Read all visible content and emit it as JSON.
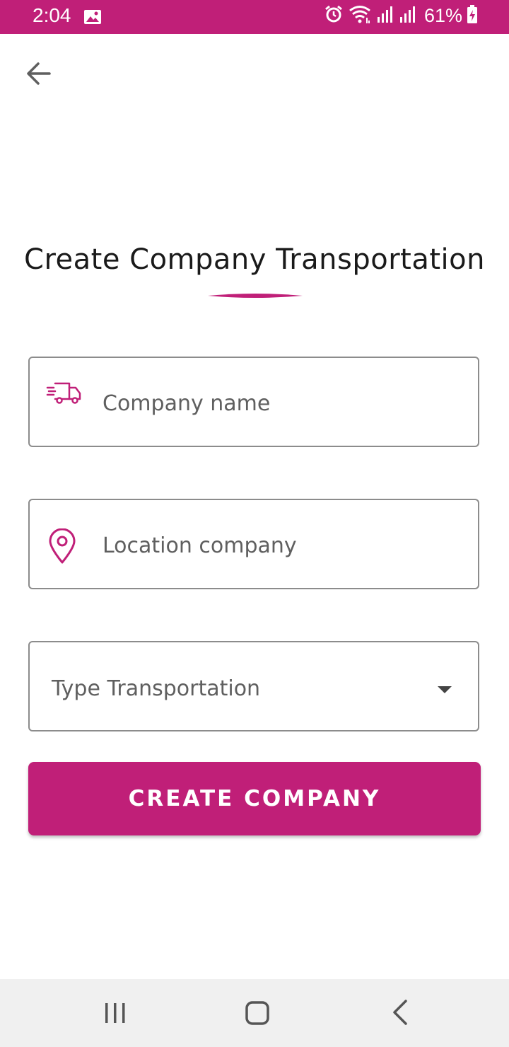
{
  "status_bar": {
    "time": "2:04",
    "battery": "61%",
    "icons": [
      "gallery-icon",
      "alarm-icon",
      "wifi-icon",
      "signal-icon",
      "signal-icon",
      "battery-charging-icon"
    ],
    "background": "#c01f78"
  },
  "header": {
    "back_icon": "arrow-left-icon"
  },
  "main": {
    "title": "Create Company Transportation",
    "accent_color": "#c01f78",
    "company_name": {
      "icon": "delivery-truck-icon",
      "placeholder": "Company name",
      "value": ""
    },
    "location": {
      "icon": "location-pin-icon",
      "placeholder": "Location company",
      "value": ""
    },
    "transport_type": {
      "selected": "Type Transportation",
      "icon": "dropdown-arrow-icon"
    },
    "create_button": "CREATE COMPANY"
  },
  "nav_bar": {
    "icons": [
      "recents-icon",
      "home-icon",
      "back-icon"
    ]
  }
}
